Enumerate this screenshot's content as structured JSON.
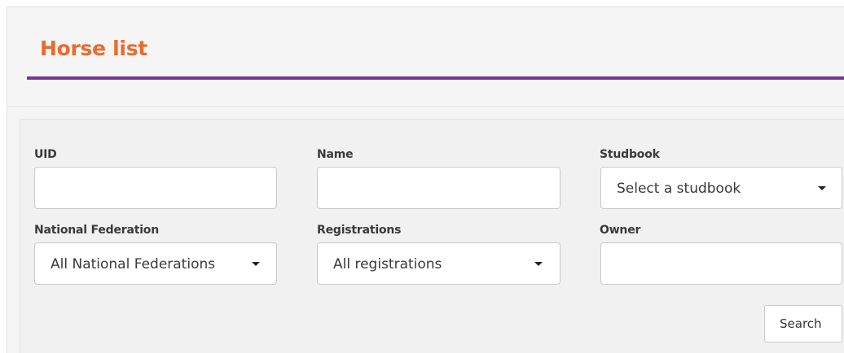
{
  "page_title": "Horse list",
  "colors": {
    "title": "#ea6b2d",
    "title_rule": "#7a3591",
    "panel_bg": "#f5f5f5",
    "filter_bg": "#f1f1f1"
  },
  "filters": {
    "uid": {
      "label": "UID",
      "value": "",
      "placeholder": ""
    },
    "name": {
      "label": "Name",
      "value": "",
      "placeholder": ""
    },
    "studbook": {
      "label": "Studbook",
      "selected": "Select a studbook",
      "icon": "caret-down-icon"
    },
    "national_federation": {
      "label": "National Federation",
      "selected": "All National Federations",
      "icon": "caret-down-icon"
    },
    "registrations": {
      "label": "Registrations",
      "selected": "All registrations",
      "icon": "caret-down-icon"
    },
    "owner": {
      "label": "Owner",
      "value": "",
      "placeholder": ""
    }
  },
  "search_button": {
    "label": "Search"
  }
}
